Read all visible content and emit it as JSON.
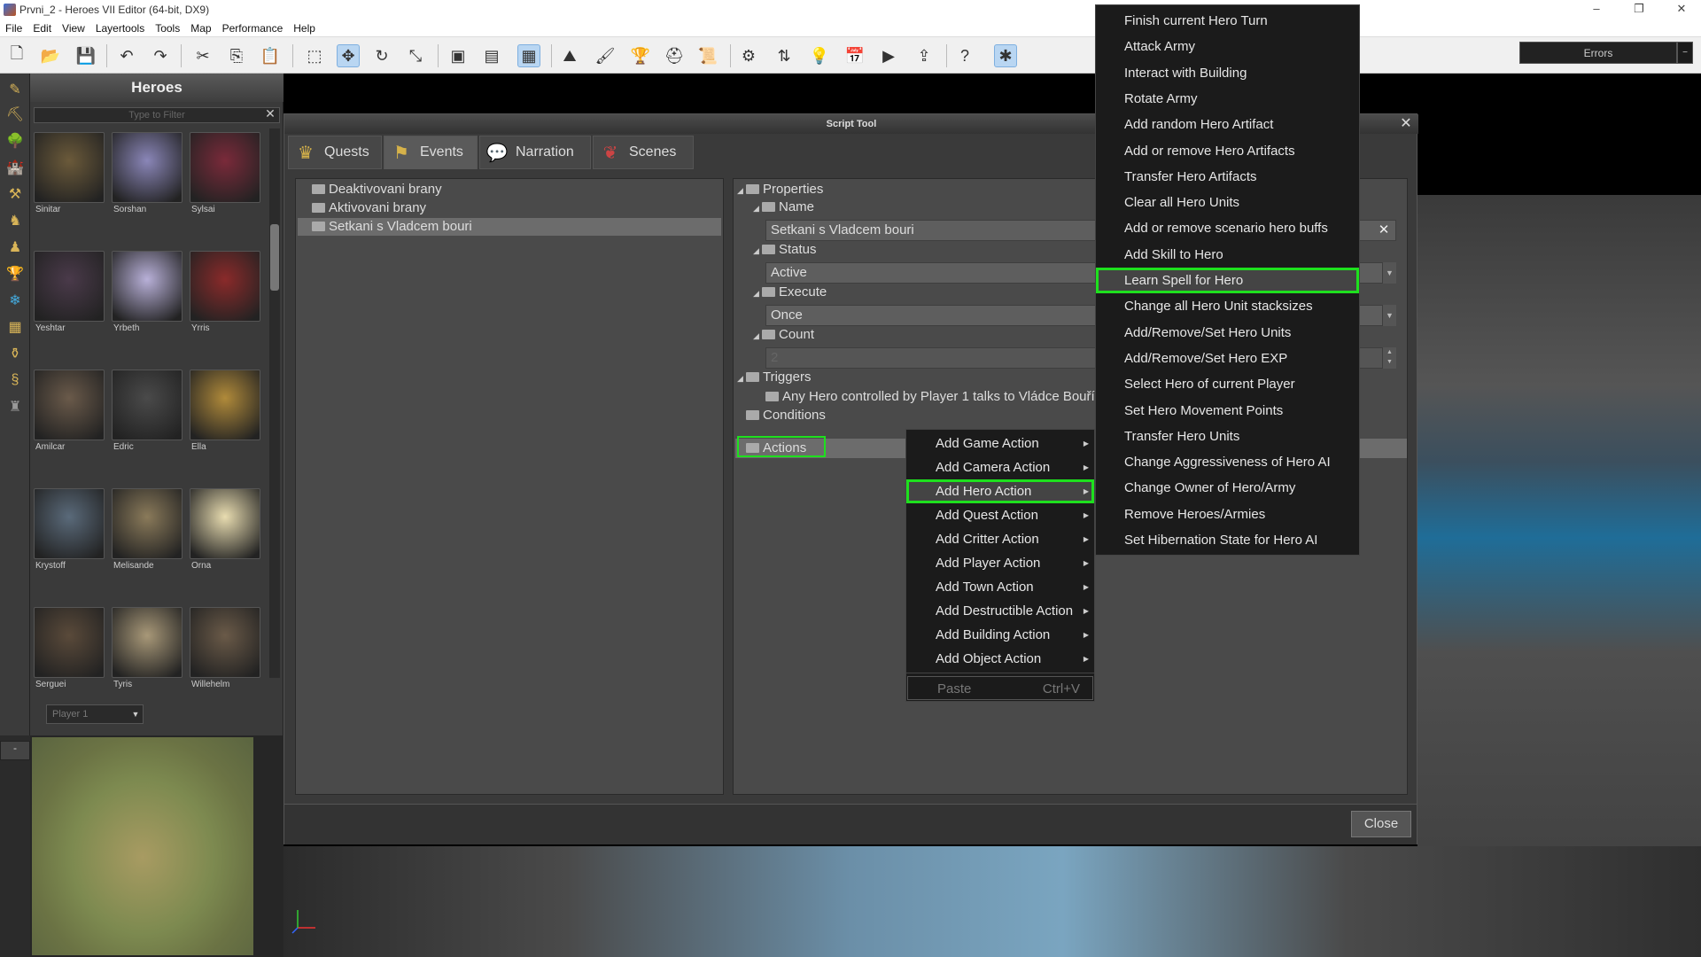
{
  "window": {
    "title": "Prvni_2 - Heroes VII Editor (64-bit, DX9)",
    "controls": {
      "minimize": "–",
      "maximize": "❐",
      "close": "✕"
    }
  },
  "menu": [
    "File",
    "Edit",
    "View",
    "Layertools",
    "Tools",
    "Map",
    "Performance",
    "Help"
  ],
  "errors_button": "Errors",
  "heroes_panel": {
    "title": "Heroes",
    "filter_placeholder": "Type to Filter",
    "heroes": [
      {
        "name": "Sinitar",
        "color": "#6b5a3a"
      },
      {
        "name": "Sorshan",
        "color": "#8a86b8"
      },
      {
        "name": "Sylsai",
        "color": "#7a2a3a"
      },
      {
        "name": "Yeshtar",
        "color": "#4a3a4a"
      },
      {
        "name": "Yrbeth",
        "color": "#b8b0d8"
      },
      {
        "name": "Yrris",
        "color": "#8a2a2a"
      },
      {
        "name": "Amilcar",
        "color": "#6a5a4a"
      },
      {
        "name": "Edric",
        "color": "#4a4a4a"
      },
      {
        "name": "Ella",
        "color": "#b08a3a"
      },
      {
        "name": "Krystoff",
        "color": "#5a6a7a"
      },
      {
        "name": "Melisande",
        "color": "#8a7a5a"
      },
      {
        "name": "Orna",
        "color": "#e8dcb0"
      },
      {
        "name": "Serguei",
        "color": "#5a4a3a"
      },
      {
        "name": "Tyris",
        "color": "#a89878"
      },
      {
        "name": "Willehelm",
        "color": "#6a5a48"
      }
    ],
    "player_select": "Player 1"
  },
  "script_tool": {
    "title": "Script Tool",
    "tabs": [
      {
        "label": "Quests",
        "icon": "trophy-icon",
        "glyph": "♛",
        "active": false
      },
      {
        "label": "Events",
        "icon": "flag-icon",
        "glyph": "⚑",
        "active": true
      },
      {
        "label": "Narration",
        "icon": "speech-bubble-icon",
        "glyph": "💬",
        "active": false
      },
      {
        "label": "Scenes",
        "icon": "scroll-icon",
        "glyph": "❦",
        "active": false
      }
    ],
    "events": [
      "Deaktivovani brany",
      "Aktivovani brany",
      "Setkani s Vladcem bouri"
    ],
    "selected_event": 2,
    "properties": {
      "root": "Properties",
      "name_label": "Name",
      "name_value": "Setkani s Vladcem bouri",
      "status_label": "Status",
      "status_value": "Active",
      "execute_label": "Execute",
      "execute_value": "Once",
      "count_label": "Count",
      "count_value": "2",
      "triggers_label": "Triggers",
      "trigger_item": "Any Hero controlled by Player 1 talks to Vládce Bouří",
      "conditions_label": "Conditions",
      "actions_label": "Actions"
    },
    "close_button": "Close"
  },
  "context_menu": {
    "items": [
      {
        "label": "Add Game Action",
        "highlighted": false
      },
      {
        "label": "Add Camera Action",
        "highlighted": false
      },
      {
        "label": "Add Hero Action",
        "highlighted": true
      },
      {
        "label": "Add Quest Action",
        "highlighted": false
      },
      {
        "label": "Add Critter Action",
        "highlighted": false
      },
      {
        "label": "Add Player Action",
        "highlighted": false
      },
      {
        "label": "Add Town Action",
        "highlighted": false
      },
      {
        "label": "Add Destructible Action",
        "highlighted": false
      },
      {
        "label": "Add Building Action",
        "highlighted": false
      },
      {
        "label": "Add Object Action",
        "highlighted": false
      }
    ],
    "paste_label": "Paste",
    "paste_shortcut": "Ctrl+V"
  },
  "hero_submenu": {
    "items": [
      "Finish current Hero Turn",
      "Attack Army",
      "Interact with Building",
      "Rotate Army",
      "Add random Hero Artifact",
      "Add or remove Hero Artifacts",
      "Transfer Hero Artifacts",
      "Clear all Hero Units",
      "Add or remove scenario hero buffs",
      "Add Skill to Hero",
      "Learn Spell for Hero",
      "Change all Hero Unit stacksizes",
      "Add/Remove/Set Hero Units",
      "Add/Remove/Set Hero EXP",
      "Select Hero of current Player",
      "Set Hero Movement Points",
      "Transfer Hero Units",
      "Change Aggressiveness of Hero AI",
      "Change Owner of Hero/Army",
      "Remove Heroes/Armies",
      "Set Hibernation State for Hero AI"
    ],
    "highlighted_index": 10
  },
  "colors": {
    "highlight": "#1ee01e",
    "menu_bg": "#1b1b1b",
    "panel_bg": "#4a4a4a"
  }
}
